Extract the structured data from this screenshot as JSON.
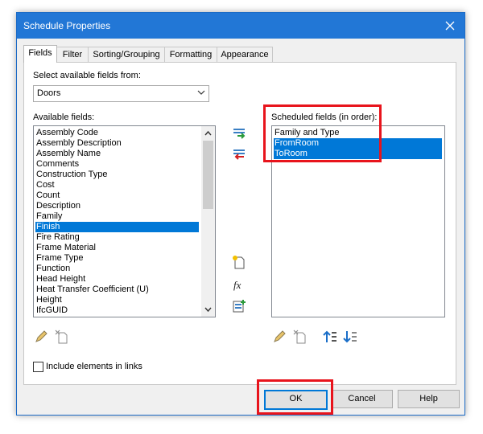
{
  "window": {
    "title": "Schedule Properties"
  },
  "tabs": [
    {
      "label": "Fields",
      "active": true
    },
    {
      "label": "Filter"
    },
    {
      "label": "Sorting/Grouping"
    },
    {
      "label": "Formatting"
    },
    {
      "label": "Appearance"
    }
  ],
  "fields_tab": {
    "select_label": "Select available fields from:",
    "category_value": "Doors",
    "available_label": "Available fields:",
    "available_items": [
      "Assembly Code",
      "Assembly Description",
      "Assembly Name",
      "Comments",
      "Construction Type",
      "Cost",
      "Count",
      "Description",
      "Family",
      "Finish",
      "Fire Rating",
      "Frame Material",
      "Frame Type",
      "Function",
      "Head Height",
      "Heat Transfer Coefficient (U)",
      "Height",
      "IfcGUID"
    ],
    "available_selected": "Finish",
    "scheduled_label": "Scheduled fields (in order):",
    "scheduled_items": [
      "Family and Type",
      "FromRoom",
      "ToRoom"
    ],
    "scheduled_selected": [
      "FromRoom",
      "ToRoom"
    ],
    "include_links_label": "Include elements in links",
    "include_links_checked": false
  },
  "buttons": {
    "ok": "OK",
    "cancel": "Cancel",
    "help": "Help"
  },
  "colors": {
    "titlebar": "#2277d6",
    "selection": "#0078d7",
    "highlight_box": "#e8141c"
  }
}
